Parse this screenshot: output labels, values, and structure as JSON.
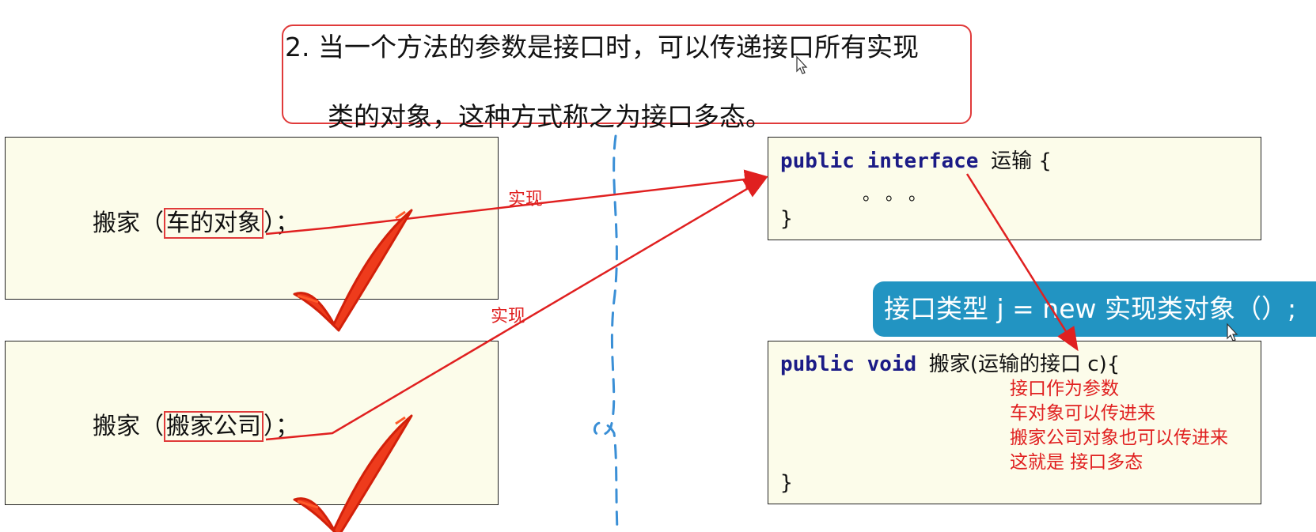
{
  "title": {
    "line1": "2.  当一个方法的参数是接口时，可以传递接口所有实现",
    "line2": "类的对象，这种方式称之为接口多态。"
  },
  "left_calls": [
    {
      "prefix": "搬家（",
      "highlight": "车的对象",
      "suffix": "）；"
    },
    {
      "prefix": "搬家（",
      "highlight": "搬家公司",
      "suffix": "）；"
    }
  ],
  "arrow_labels": [
    "实现",
    "实现"
  ],
  "interface_code": {
    "kw1": "public",
    "kw2": "interface",
    "name": "运输 {",
    "dots": "。 。 。",
    "close": "}"
  },
  "banner": "接口类型 j = new 实现类对象（）;",
  "method_code": {
    "kw1": "public",
    "kw2": "void",
    "signature": "搬家(运输的接口 c){",
    "close": "}"
  },
  "notes": [
    "接口作为参数",
    "车对象可以传进来",
    "搬家公司对象也可以传进来",
    "这就是 接口多态"
  ],
  "colors": {
    "accent_red": "#e03a3a",
    "panel_bg": "#fcfcea",
    "banner_blue": "#2294c2",
    "keyword": "#1b1b86"
  }
}
